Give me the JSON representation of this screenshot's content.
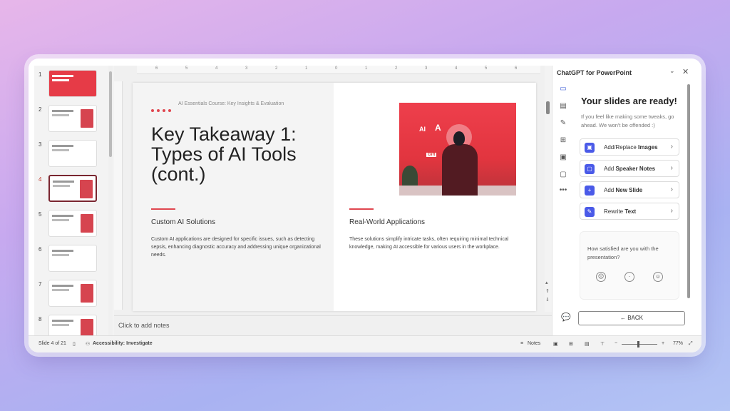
{
  "thumbnails": [
    {
      "num": "1",
      "style": "red"
    },
    {
      "num": "2",
      "style": "photo"
    },
    {
      "num": "3",
      "style": "plain"
    },
    {
      "num": "4",
      "style": "photo",
      "active": true
    },
    {
      "num": "5",
      "style": "photo"
    },
    {
      "num": "6",
      "style": "plain"
    },
    {
      "num": "7",
      "style": "photo"
    },
    {
      "num": "8",
      "style": "photo"
    }
  ],
  "ruler": [
    "6",
    "5",
    "4",
    "3",
    "2",
    "1",
    "0",
    "1",
    "2",
    "3",
    "4",
    "5",
    "6"
  ],
  "slide": {
    "course": "AI Essentials Course: Key Insights & Evaluation",
    "title": "Key Takeaway 1: Types of AI Tools (cont.)",
    "left_sub": "Custom AI Solutions",
    "left_body": "Custom AI applications are designed for specific issues, such as detecting sepsis, enhancing diagnostic accuracy and addressing unique organizational needs.",
    "right_sub": "Real-World Applications",
    "right_body": "These solutions simplify intricate tasks, often requiring minimal technical knowledge, making AI accessible for various users in the workplace.",
    "photo_labels": [
      "AI",
      "A",
      "Gift"
    ],
    "accent": "#e0464f"
  },
  "notes_placeholder": "Click to add notes",
  "pane": {
    "title": "ChatGPT for PowerPoint",
    "heading": "Your slides are ready!",
    "subtext": "If you feel like making some tweaks, go ahead. We won't be offended :)",
    "actions": [
      {
        "pre": "Add/Replace ",
        "bold": "Images",
        "icon": "image-icon"
      },
      {
        "pre": "Add ",
        "bold": "Speaker Notes",
        "icon": "note-icon"
      },
      {
        "pre": "Add ",
        "bold": "New Slide",
        "icon": "new-slide-icon"
      },
      {
        "pre": "Rewrite ",
        "bold": "Text",
        "icon": "pencil-icon"
      }
    ],
    "satisfaction_q": "How satisfied are you with the presentation?",
    "back_label": "BACK",
    "accent": "#4a5ae8"
  },
  "status": {
    "slide_count": "Slide 4 of 21",
    "accessibility": "Accessibility: Investigate",
    "notes": "Notes",
    "zoom": "77%"
  }
}
